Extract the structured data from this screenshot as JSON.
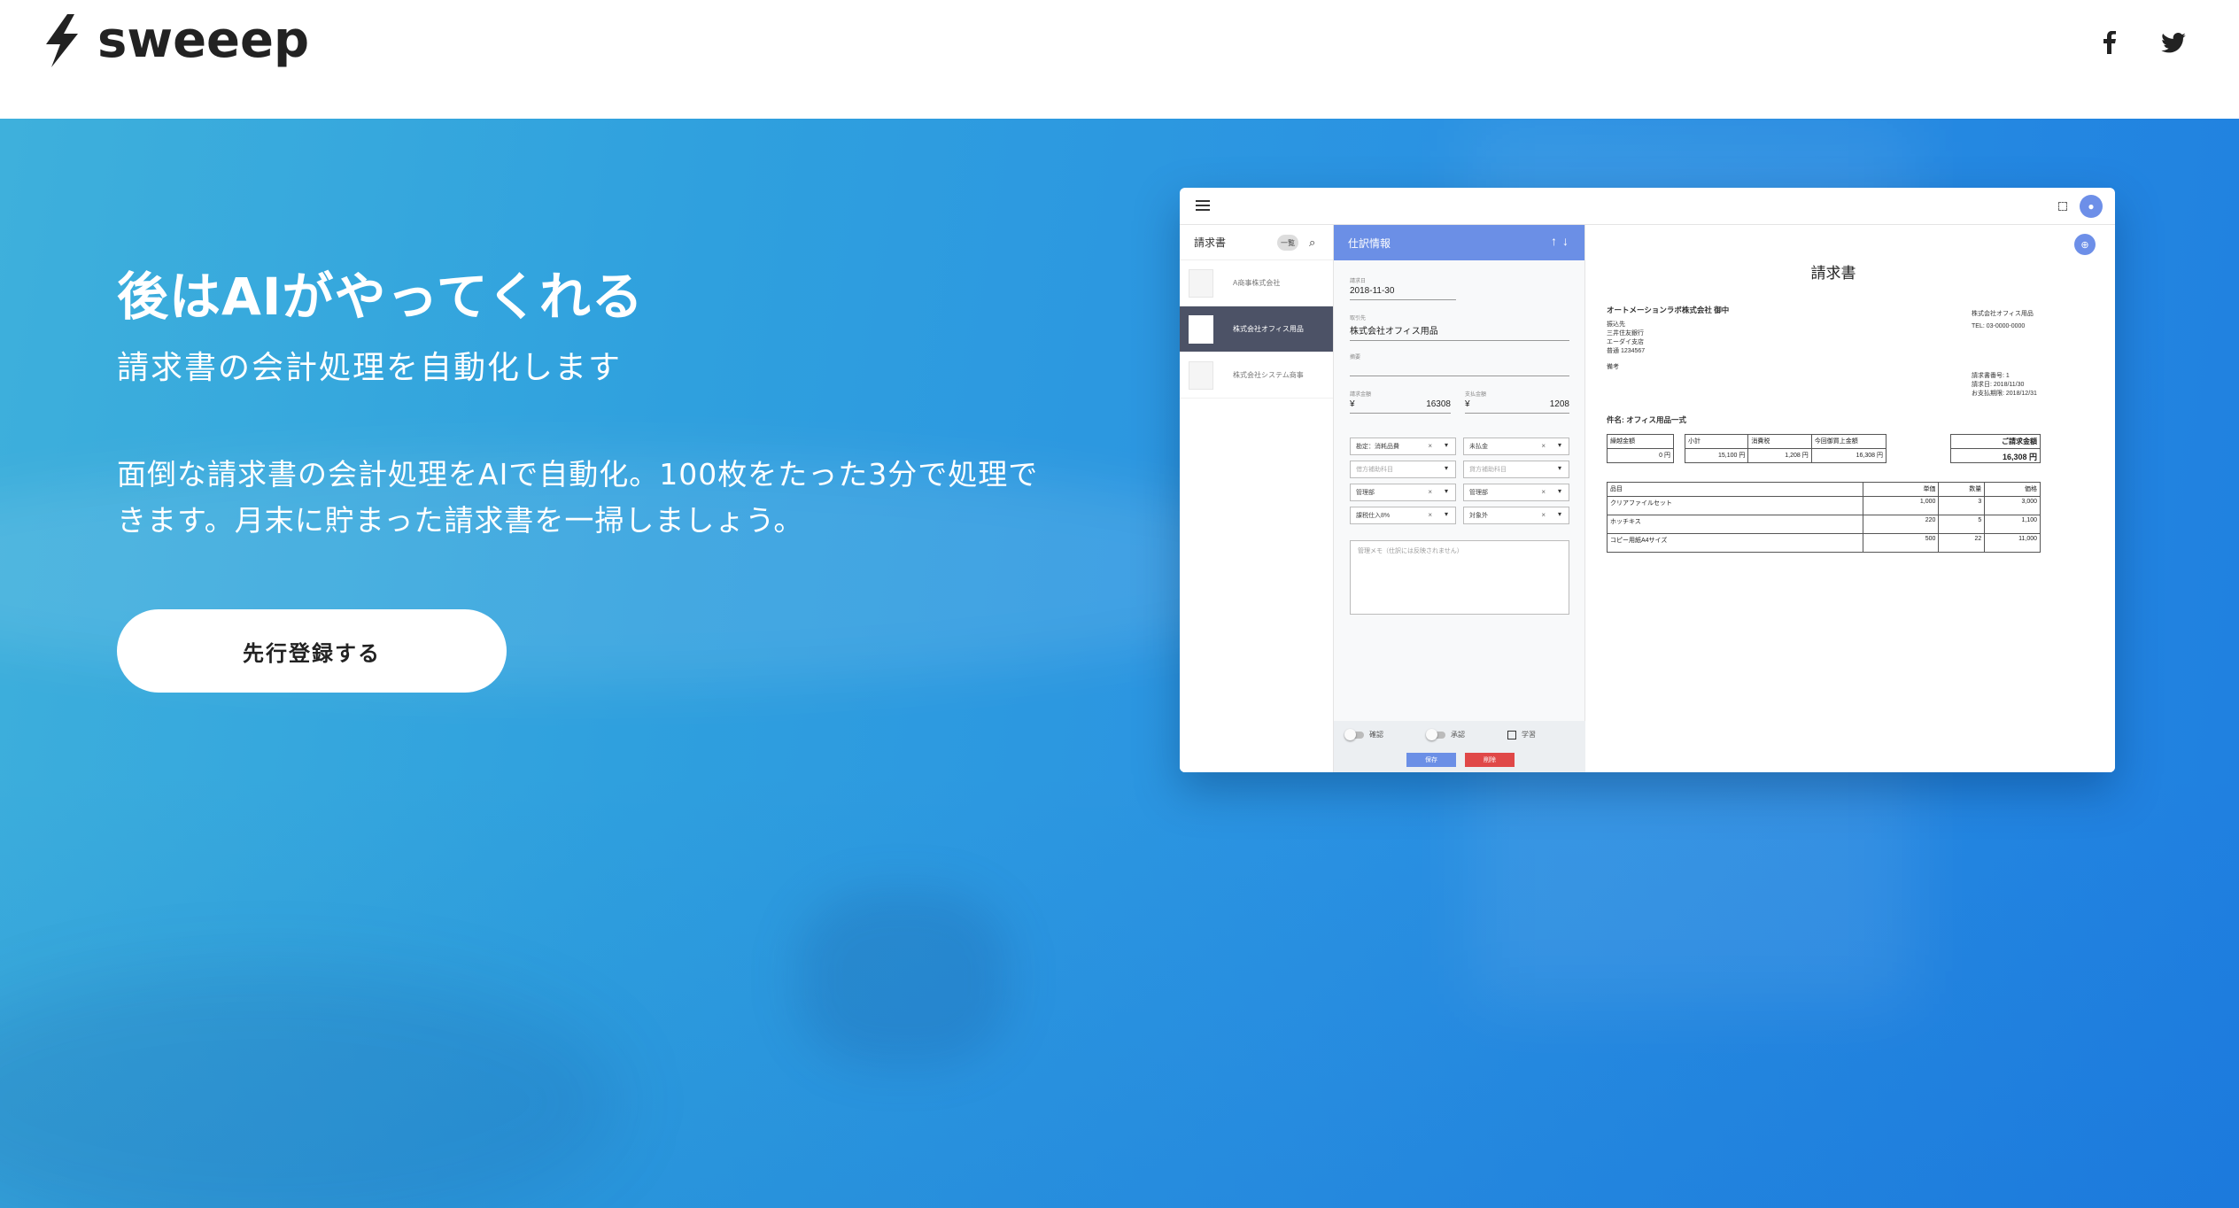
{
  "header": {
    "brand": "sweeep",
    "social": [
      "facebook-icon",
      "twitter-icon"
    ]
  },
  "hero": {
    "title": "後はAIがやってくれる",
    "subtitle": "請求書の会計処理を自動化します",
    "description": "面倒な請求書の会計処理をAIで自動化。100枚をたった3分で処理できます。月末に貯まった請求書を一掃しましょう。",
    "cta_label": "先行登録する"
  },
  "app": {
    "list": {
      "title": "請求書",
      "chip": "一覧",
      "items": [
        "A商事株式会社",
        "株式会社オフィス用品",
        "株式会社システム商事"
      ]
    },
    "form": {
      "title": "仕訳情報",
      "arrows": "↑↓",
      "date_label": "請求日",
      "date_value": "2018-11-30",
      "vendor_label": "取引先",
      "vendor_value": "株式会社オフィス用品",
      "summary_label": "摘要",
      "amount_label": "請求金額",
      "amount_value": "16308",
      "tax_label": "支払金額",
      "tax_value": "1208",
      "yen": "¥",
      "selects": [
        "勘定：消耗品費",
        "未払金",
        "借方補助科目",
        "貸方補助科目",
        "管理部",
        "管理部",
        "課税仕入8%",
        "対象外"
      ],
      "memo_placeholder": "管理メモ（仕訳には反映されません）",
      "toggle1": "確認",
      "toggle2": "承認",
      "checkbox": "学習",
      "save_label": "保存",
      "delete_label": "削除"
    },
    "invoice": {
      "title": "請求書",
      "recipient": "オートメーションラボ株式会社 御中",
      "issuer_name": "株式会社オフィス用品",
      "issuer_tel": "TEL: 03-0000-0000",
      "bank_lines": [
        "振込先",
        "三井住友銀行",
        "エーダイ支店",
        "普通 1234567"
      ],
      "note_label": "備考",
      "meta_lines": [
        "請求書番号: 1",
        "請求日: 2018/11/30",
        "お支払期限: 2018/12/31"
      ],
      "subject": "件名: オフィス用品一式",
      "summary_headers": [
        "繰越金額",
        "小計",
        "消費税",
        "今回御買上金額"
      ],
      "summary_values": [
        "0 円",
        "15,100 円",
        "1,208 円",
        "16,308 円"
      ],
      "total_label": "ご請求金額",
      "total_value": "16,308 円",
      "item_headers": [
        "品目",
        "単価",
        "数量",
        "価格"
      ],
      "items": [
        [
          "クリアファイルセット",
          "1,000",
          "3",
          "3,000"
        ],
        [
          "ホッチキス",
          "220",
          "5",
          "1,100"
        ],
        [
          "コピー用紙A4サイズ",
          "500",
          "22",
          "11,000"
        ]
      ]
    }
  }
}
